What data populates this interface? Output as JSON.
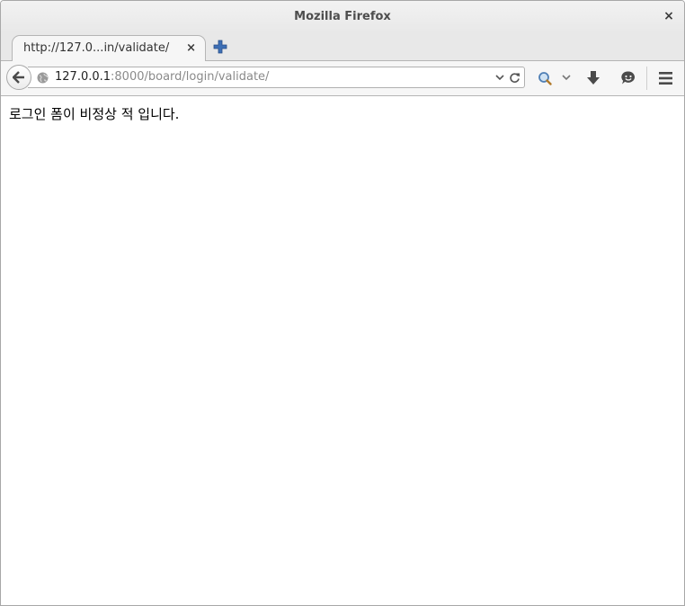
{
  "window": {
    "title": "Mozilla Firefox",
    "close_glyph": "×"
  },
  "tabs": [
    {
      "title": "http://127.0...in/validate/",
      "close_glyph": "×",
      "active": true
    }
  ],
  "tabstrip": {
    "new_tab_icon": "plus-icon"
  },
  "navbar": {
    "back_icon": "arrow-left-icon",
    "url_host": "127.0.0.1",
    "url_path": ":8000/board/login/validate/",
    "site_icon": "globe-icon",
    "dropdown_icon": "chevron-down-icon",
    "reload_icon": "reload-icon",
    "search_icon": "magnifier-icon",
    "download_icon": "download-arrow-icon",
    "social_icon": "smiley-icon",
    "menu_icon": "hamburger-icon"
  },
  "page": {
    "message": "로그인 폼이 비정상 적 입니다."
  },
  "colors": {
    "accent_plus": "#3d6fb5",
    "chrome_bg": "#e8e8e8",
    "toolbar_bg": "#f6f6f6"
  }
}
